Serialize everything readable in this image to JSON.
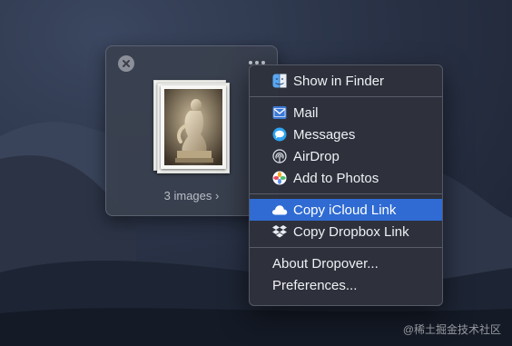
{
  "shelf": {
    "close_icon": "close-circle-icon",
    "more_icon": "ellipsis-icon",
    "images_label": "3 images",
    "chevron": "›"
  },
  "menu": {
    "show_in_finder": {
      "label": "Show in Finder",
      "icon": "finder-icon"
    },
    "share_items": [
      {
        "label": "Mail",
        "icon": "mail-icon"
      },
      {
        "label": "Messages",
        "icon": "messages-icon"
      },
      {
        "label": "AirDrop",
        "icon": "airdrop-icon"
      },
      {
        "label": "Add to Photos",
        "icon": "photos-icon"
      }
    ],
    "link_items": [
      {
        "label": "Copy iCloud Link",
        "icon": "icloud-icon",
        "highlighted": true
      },
      {
        "label": "Copy Dropbox Link",
        "icon": "dropbox-icon",
        "highlighted": false
      }
    ],
    "app_items": [
      {
        "label": "About Dropover..."
      },
      {
        "label": "Preferences..."
      }
    ],
    "highlight_color": "#2f6bd3"
  },
  "watermark": "@稀土掘金技术社区"
}
